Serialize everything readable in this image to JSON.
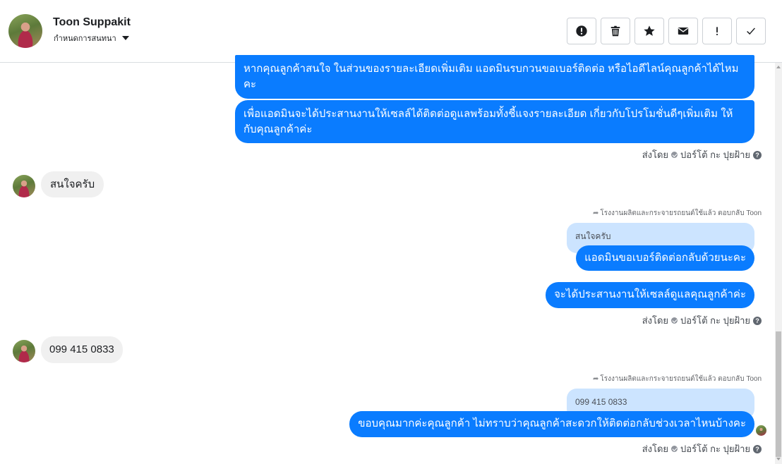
{
  "header": {
    "contact_name": "Toon Suppakit",
    "subtitle": "กำหนดการสนทนา",
    "actions": [
      {
        "icon": "exclamation-circle-icon"
      },
      {
        "icon": "trash-icon"
      },
      {
        "icon": "star-icon"
      },
      {
        "icon": "envelope-icon"
      },
      {
        "icon": "exclamation-icon"
      },
      {
        "icon": "checkmark-icon"
      }
    ]
  },
  "messages": {
    "out_1": "หากคุณลูกค้าสนใจ ในส่วนของรายละเอียดเพิ่มเติม แอดมินรบกวนขอเบอร์ติดต่อ หรือไอดีไลน์คุณลูกค้าได้ไหม คะ",
    "out_2": "เพื่อแอดมินจะได้ประสานงานให้เซลล์ได้ติดต่อดูแลพร้อมทั้งชี้แจงรายละเอียด เกี่ยวกับโปรโมชั่นดีๆเพิ่มเติม ให้กับคุณลูกค้าค่ะ",
    "sent_by_1": "ส่งโดย",
    "sender_1": "ปอร์โต้ กะ ปุยฝ้าย",
    "in_1": "สนใจครับ",
    "reply_info_1": "โรงงานผลิตและกระจายรถยนต์ใช้แล้ว ตอบกลับ Toon",
    "quote_1": "สนใจครับ",
    "out_3": "แอดมินขอเบอร์ติดต่อกลับด้วยนะคะ",
    "out_4": "จะได้ประสานงานให้เซลล์ดูแลคุณลูกค้าค่ะ",
    "sent_by_2": "ส่งโดย",
    "sender_2": "ปอร์โต้ กะ ปุยฝ้าย",
    "in_2": "099 415 0833",
    "reply_info_2": "โรงงานผลิตและกระจายรถยนต์ใช้แล้ว ตอบกลับ Toon",
    "quote_2": "099 415 0833",
    "out_5": "ขอบคุณมากค่ะคุณลูกค้า ไม่ทราบว่าคุณลูกค้าสะดวกให้ติดต่อกลับช่วงเวลาไหนบ้างคะ",
    "sent_by_3": "ส่งโดย",
    "sender_3": "ปอร์โต้ กะ ปุยฝ้าย"
  },
  "colors": {
    "outgoing_bubble": "#0a7cff",
    "incoming_bubble": "#f0f0f0",
    "quoted_bubble": "#cce4ff"
  }
}
